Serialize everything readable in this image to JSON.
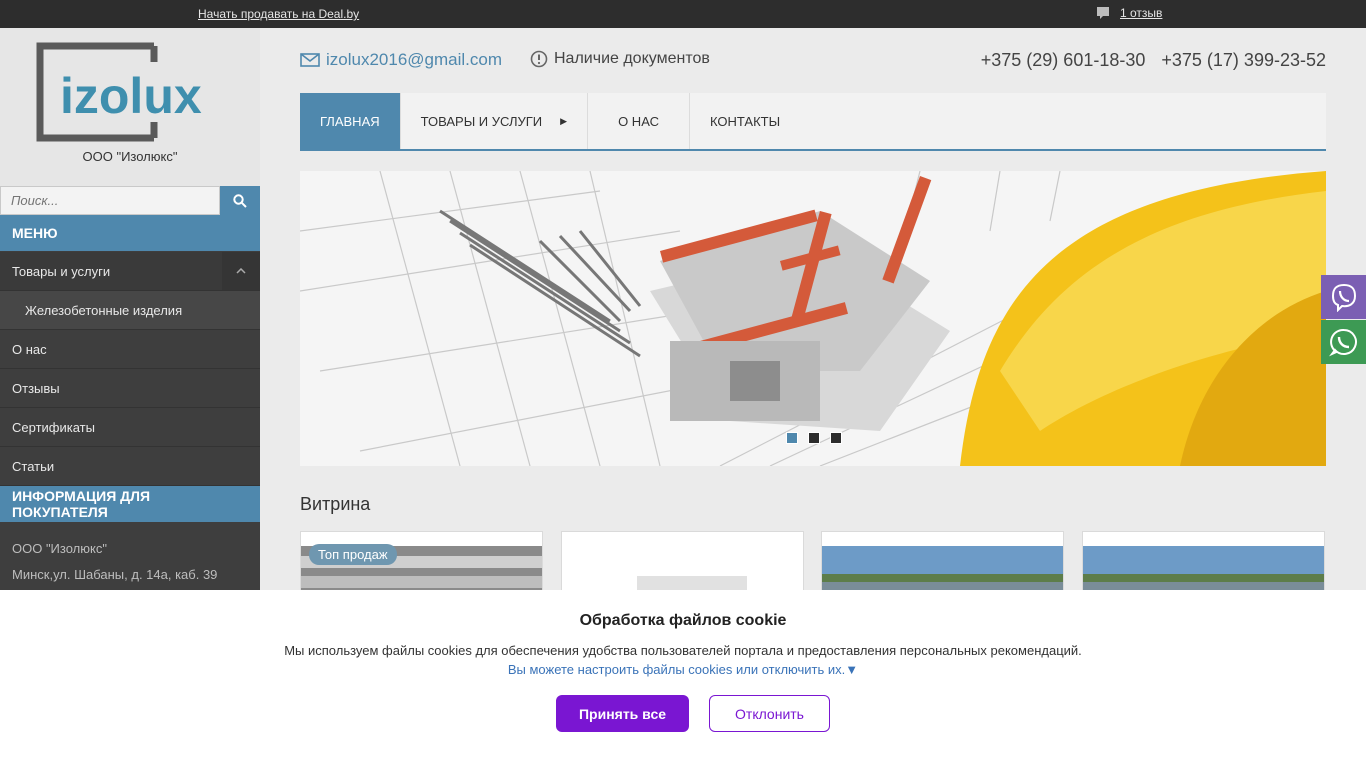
{
  "topbar": {
    "sell_link": "Начать продавать на Deal.by",
    "reviews_link": "1 отзыв"
  },
  "brand": {
    "logo_text": "izolux",
    "company_name": "ООО \"Изолюкс\"",
    "accent": "#4f88ad"
  },
  "search": {
    "placeholder": "Поиск..."
  },
  "sidebar": {
    "menu_title": "МЕНЮ",
    "items": [
      {
        "label": "Товары и услуги"
      },
      {
        "label": "Железобетонные изделия"
      },
      {
        "label": "О нас"
      },
      {
        "label": "Отзывы"
      },
      {
        "label": "Сертификаты"
      },
      {
        "label": "Статьи"
      }
    ],
    "info_title": "ИНФОРМАЦИЯ ДЛЯ ПОКУПАТЕЛЯ",
    "info_company": "ООО \"Изолюкс\"",
    "info_address": "Минск,ул. Шабаны, д. 14а, каб. 39"
  },
  "header": {
    "email": "izolux2016@gmail.com",
    "docs": "Наличие документов",
    "phone1": "+375 (29) 601-18-30",
    "phone2": "+375 (17) 399-23-52"
  },
  "nav": {
    "tabs": [
      {
        "label": "ГЛАВНАЯ"
      },
      {
        "label": "ТОВАРЫ И УСЛУГИ"
      },
      {
        "label": "О НАС"
      },
      {
        "label": "КОНТАКТЫ"
      }
    ]
  },
  "showcase": {
    "title": "Витрина",
    "badge": "Топ продаж"
  },
  "cookie": {
    "title": "Обработка файлов cookie",
    "text": "Мы используем файлы cookies для обеспечения удобства пользователей портала и предоставления персональных рекомендаций.",
    "link": "Вы можете настроить файлы cookies или отключить их.▼",
    "accept": "Принять все",
    "decline": "Отклонить"
  }
}
